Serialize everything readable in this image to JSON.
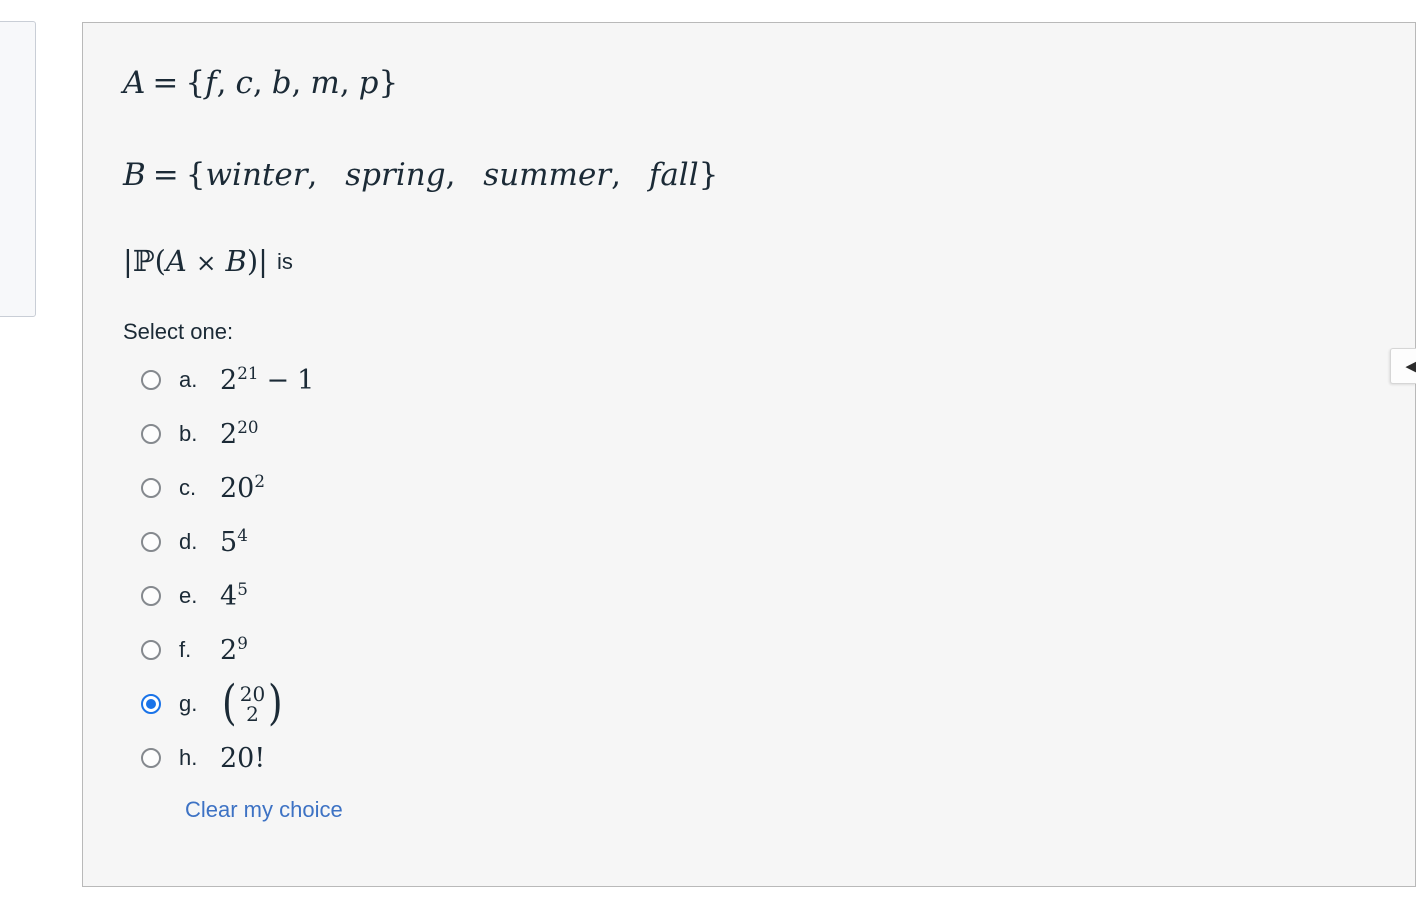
{
  "window": {
    "background": "#ffffff",
    "card_background": "#f6f6f6",
    "card_border": "#b9b9b9"
  },
  "side_panel": {
    "name": "left-side-panel-partial"
  },
  "question": {
    "set_a": {
      "name": "A",
      "equals": "=",
      "open_brace": "{",
      "elements": [
        "f",
        "c",
        "b",
        "m",
        "p"
      ],
      "close_brace": "}"
    },
    "set_b": {
      "name": "B",
      "equals": "=",
      "open_brace": "{",
      "elements": [
        "winter",
        "spring",
        "summer",
        "fall"
      ],
      "close_brace": "}"
    },
    "expression": {
      "left_bar": "|",
      "power_set": "ℙ",
      "open_paren": "(",
      "first": "A",
      "cross": "×",
      "second": "B",
      "close_paren": ")",
      "right_bar": "|",
      "suffix": "is"
    }
  },
  "answers": {
    "prompt": "Select one:",
    "selected": "g",
    "options": [
      {
        "letter": "a.",
        "type": "power_minus",
        "base": "2",
        "exp": "21",
        "minus": "−",
        "tail": "1",
        "value_text": "2^21 - 1"
      },
      {
        "letter": "b.",
        "type": "power",
        "base": "2",
        "exp": "20",
        "value_text": "2^20"
      },
      {
        "letter": "c.",
        "type": "power",
        "base": "20",
        "exp": "2",
        "value_text": "20^2"
      },
      {
        "letter": "d.",
        "type": "power",
        "base": "5",
        "exp": "4",
        "value_text": "5^4"
      },
      {
        "letter": "e.",
        "type": "power",
        "base": "4",
        "exp": "5",
        "value_text": "4^5"
      },
      {
        "letter": "f.",
        "type": "power",
        "base": "2",
        "exp": "9",
        "value_text": "2^9"
      },
      {
        "letter": "g.",
        "type": "binomial",
        "top": "20",
        "bottom": "2",
        "value_text": "(20 choose 2)"
      },
      {
        "letter": "h.",
        "type": "plain",
        "base": "20!",
        "value_text": "20!"
      }
    ],
    "clear_link": "Clear my choice",
    "clear_link_color": "#3d72c4",
    "selected_radio_color": "#1a73e8"
  },
  "drawer_tab": {
    "icon": "chevron-left-icon",
    "glyph": "◀"
  }
}
